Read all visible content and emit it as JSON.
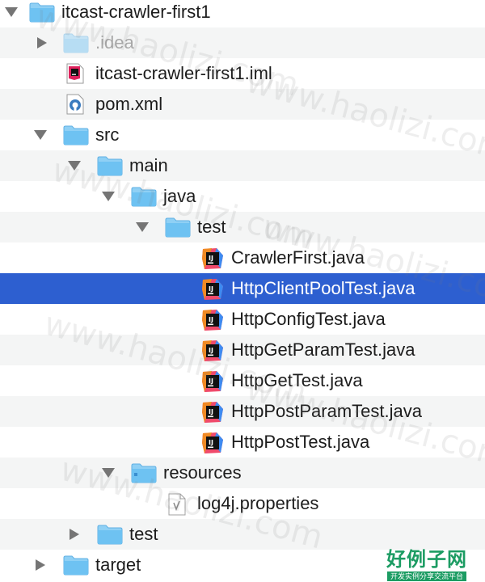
{
  "tree": {
    "items": [
      {
        "label": "itcast-crawler-first1",
        "icon": "folder-icon",
        "disclosure": "expanded"
      },
      {
        "label": ".idea",
        "icon": "folder-icon",
        "disclosure": "collapsed",
        "dimmed": true
      },
      {
        "label": "itcast-crawler-first1.iml",
        "icon": "intellij-file-icon",
        "disclosure": "none"
      },
      {
        "label": "pom.xml",
        "icon": "maven-file-icon",
        "disclosure": "none"
      },
      {
        "label": "src",
        "icon": "folder-icon",
        "disclosure": "expanded"
      },
      {
        "label": "main",
        "icon": "folder-icon",
        "disclosure": "expanded"
      },
      {
        "label": "java",
        "icon": "folder-icon",
        "disclosure": "expanded"
      },
      {
        "label": "test",
        "icon": "folder-icon",
        "disclosure": "expanded"
      },
      {
        "label": "CrawlerFirst.java",
        "icon": "java-file-icon",
        "disclosure": "none"
      },
      {
        "label": "HttpClientPoolTest.java",
        "icon": "java-file-icon",
        "disclosure": "none",
        "selected": true
      },
      {
        "label": "HttpConfigTest.java",
        "icon": "java-file-icon",
        "disclosure": "none"
      },
      {
        "label": "HttpGetParamTest.java",
        "icon": "java-file-icon",
        "disclosure": "none"
      },
      {
        "label": "HttpGetTest.java",
        "icon": "java-file-icon",
        "disclosure": "none"
      },
      {
        "label": "HttpPostParamTest.java",
        "icon": "java-file-icon",
        "disclosure": "none"
      },
      {
        "label": "HttpPostTest.java",
        "icon": "java-file-icon",
        "disclosure": "none"
      },
      {
        "label": "resources",
        "icon": "resources-folder-icon",
        "disclosure": "expanded"
      },
      {
        "label": "log4j.properties",
        "icon": "text-file-icon",
        "disclosure": "none"
      },
      {
        "label": "test",
        "icon": "folder-icon",
        "disclosure": "collapsed"
      },
      {
        "label": "target",
        "icon": "folder-icon",
        "disclosure": "collapsed"
      }
    ]
  },
  "watermark": "www.haolizi.com",
  "logo": {
    "title": "好例子网",
    "subtitle": "开发实例分享交流平台"
  },
  "colors": {
    "selection": "#2d5fd0",
    "folder": "#67bdf0",
    "alt_row": "#f4f5f5"
  }
}
